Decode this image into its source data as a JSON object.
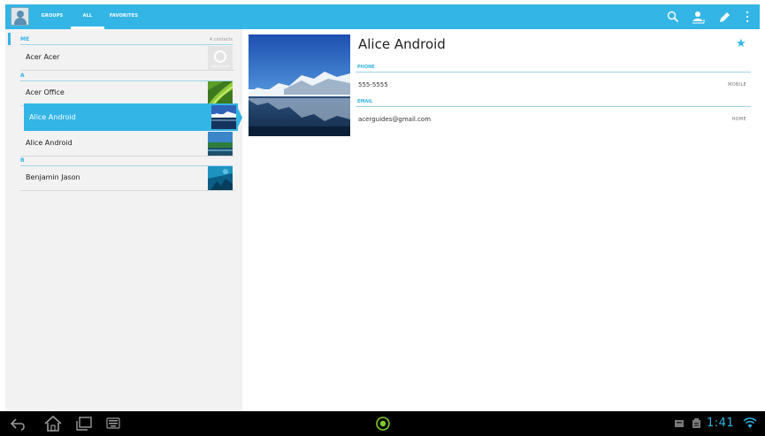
{
  "tabs": {
    "groups": "GROUPS",
    "all": "ALL",
    "favorites": "FAVORITES"
  },
  "action_icons": [
    "search-icon",
    "add-contact-icon",
    "edit-icon",
    "overflow-menu-icon"
  ],
  "list": {
    "me_header": "ME",
    "me_count": "4 contacts",
    "me_contact": "Acer Acer",
    "sections": [
      {
        "letter": "A",
        "contacts": [
          "Acer Office",
          "Alice Android",
          "Alice Android"
        ]
      },
      {
        "letter": "B",
        "contacts": [
          "Benjamin Jason"
        ]
      }
    ],
    "selected_contact": "Alice Android"
  },
  "detail": {
    "name": "Alice Android",
    "starred": true,
    "phone_header": "PHONE",
    "phone_number": "555-5555",
    "phone_type": "MOBILE",
    "email_header": "EMAIL",
    "email": "acerguides@gmail.com",
    "email_type": "HOME"
  },
  "status_bar": {
    "time": "1:41"
  },
  "colors": {
    "accent": "#33b5e5",
    "list_bg": "#f2f2f2",
    "system_bar": "#000000"
  }
}
